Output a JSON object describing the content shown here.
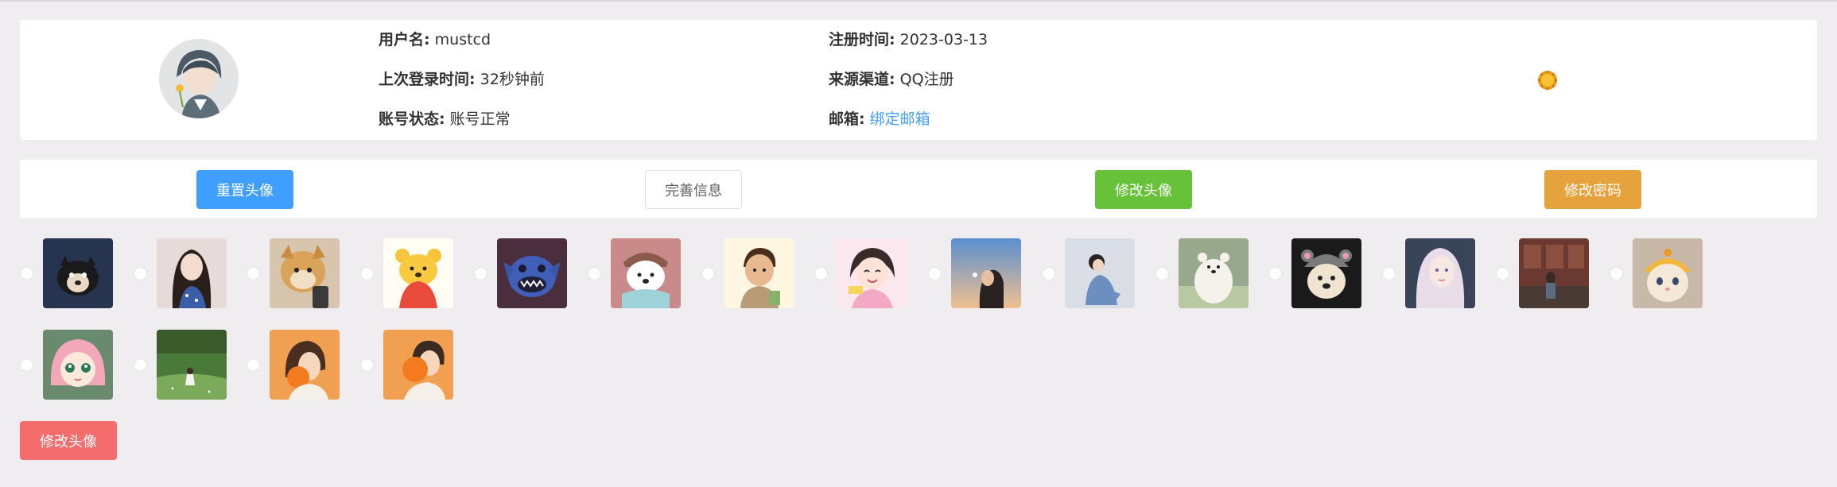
{
  "profile": {
    "username_label": "用户名:",
    "username": "mustcd",
    "register_label": "注册时间:",
    "register_date": "2023-03-13",
    "last_login_label": "上次登录时间:",
    "last_login": "32秒钟前",
    "source_label": "来源渠道:",
    "source": "QQ注册",
    "status_label": "账号状态:",
    "status": "账号正常",
    "email_label": "邮箱:",
    "email_link": "绑定邮箱"
  },
  "actions": {
    "reset_avatar": "重置头像",
    "complete_info": "完善信息",
    "change_avatar": "修改头像",
    "change_password": "修改密码"
  },
  "avatar_options": [
    {
      "icon": "black-dog-avatar"
    },
    {
      "icon": "long-hair-girl-avatar"
    },
    {
      "icon": "shiba-dog-avatar"
    },
    {
      "icon": "winnie-bear-avatar"
    },
    {
      "icon": "stitch-avatar"
    },
    {
      "icon": "ice-bear-avatar"
    },
    {
      "icon": "cartoon-boy-avatar"
    },
    {
      "icon": "smiling-girl-avatar"
    },
    {
      "icon": "sunset-girl-avatar"
    },
    {
      "icon": "sitting-girl-avatar"
    },
    {
      "icon": "white-bear-avatar"
    },
    {
      "icon": "hat-dog-avatar"
    },
    {
      "icon": "anime-girl-avatar"
    },
    {
      "icon": "city-scene-avatar"
    },
    {
      "icon": "yellow-hat-cat-avatar"
    },
    {
      "icon": "pink-hair-girl-avatar"
    },
    {
      "icon": "grass-field-avatar"
    },
    {
      "icon": "orange-girl-avatar"
    },
    {
      "icon": "orange-boy-avatar"
    }
  ],
  "submit_label": "修改头像",
  "colors": {
    "primary": "#409eff",
    "success": "#67c23a",
    "warning": "#e6a23c",
    "danger": "#f56c6c",
    "background": "#efedef"
  }
}
